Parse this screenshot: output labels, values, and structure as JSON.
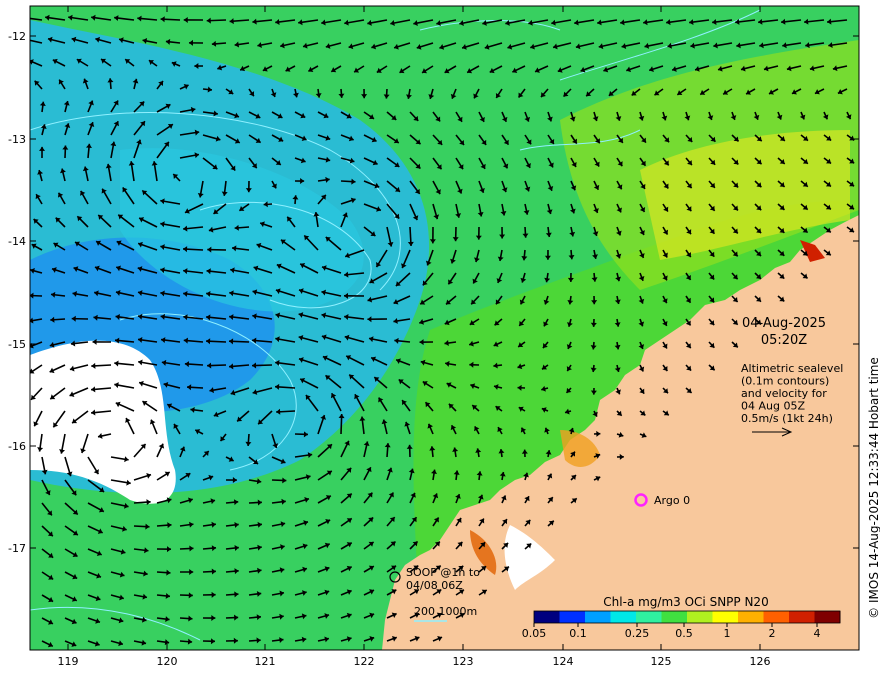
{
  "map": {
    "lon_ticks": [
      "119",
      "120",
      "121",
      "122",
      "123",
      "124",
      "125",
      "126"
    ],
    "lat_ticks": [
      "-12",
      "-13",
      "-14",
      "-15",
      "-16",
      "-17"
    ],
    "lon_range": [
      118.6,
      127.0
    ],
    "lat_range": [
      -11.8,
      -17.9
    ],
    "colors": {
      "land": "#f8c89c",
      "no_data": "#ffffff",
      "contour": "#8ff0ff",
      "argo": "#ff22ff",
      "arrow": "#000000"
    }
  },
  "annotation": {
    "date": "04-Aug-2025",
    "time": "05:20Z",
    "desc_lines": [
      "Altimetric sealevel",
      "(0.1m contours)",
      "and velocity for",
      "04 Aug 05Z",
      "0.5m/s (1kt 24h)"
    ],
    "argo_label": "Argo 0",
    "soop_line1": "SOOP @1h to",
    "soop_line2": "04/08 06Z",
    "bathy_label": "200  1000m"
  },
  "colorbar": {
    "title": "Chl-a mg/m3 OCi SNPP N20",
    "tick_labels": [
      "0.05",
      "0.1",
      "0.25",
      "0.5",
      "1",
      "2",
      "4"
    ],
    "colors": [
      "#00007f",
      "#0030ff",
      "#00a0ff",
      "#00e8e8",
      "#30f0a0",
      "#40e040",
      "#b0f020",
      "#ffff00",
      "#ffb000",
      "#ff6000",
      "#d02000",
      "#7f0000"
    ]
  },
  "credit": "© IMOS 14-Aug-2025 12:33:44 Hobart time"
}
